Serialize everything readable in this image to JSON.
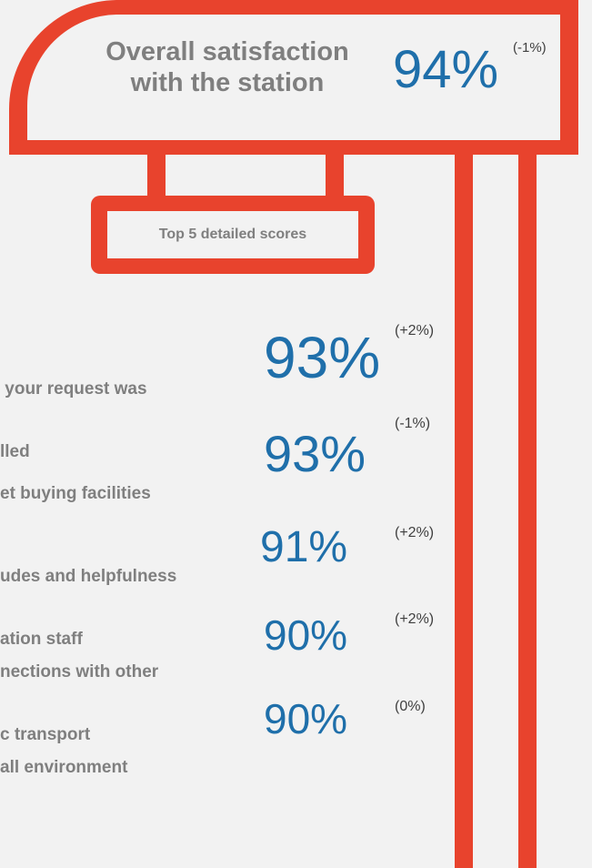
{
  "overall": {
    "label_line1": "Overall satisfaction",
    "label_line2": "with the station",
    "value": "94%",
    "change": "(-1%)"
  },
  "top_scores_title": "Top 5 detailed scores",
  "scores": [
    {
      "label_line1": " your request was",
      "label_line2": "lled",
      "value": "93%",
      "change": "(+2%)"
    },
    {
      "label_line1": "et buying facilities",
      "label_line2": "",
      "value": "93%",
      "change": "(-1%)"
    },
    {
      "label_line1": "udes and helpfulness",
      "label_line2": "ation staff",
      "value": "91%",
      "change": "(+2%)"
    },
    {
      "label_line1": "nections with other",
      "label_line2": "c transport",
      "value": "90%",
      "change": "(+2%)"
    },
    {
      "label_line1": "all environment",
      "label_line2": "",
      "value": "90%",
      "change": "(0%)"
    }
  ],
  "colors": {
    "accent_red": "#e8432d",
    "value_blue": "#1f6faa",
    "label_grey": "#7f7f7f",
    "background": "#f2f2f2"
  }
}
